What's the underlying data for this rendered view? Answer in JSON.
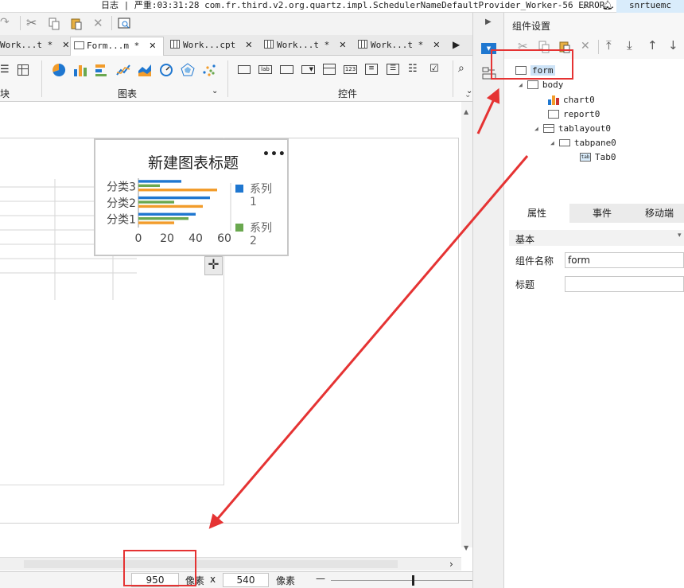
{
  "logbar": {
    "text": "日志 | 严重:03:31:28 com.fr.third.v2.org.quartz.impl.SchedulerNameDefaultProvider_Worker-56 ERROR...",
    "user": "snrtuemc"
  },
  "tabs": [
    {
      "label": "Work...t *",
      "active": false
    },
    {
      "label": "Form...m *",
      "active": true
    },
    {
      "label": "Work...cpt",
      "active": false
    },
    {
      "label": "Work...t *",
      "active": false
    },
    {
      "label": "Work...t *",
      "active": false
    }
  ],
  "ribbon": {
    "group_left": "块",
    "group_chart": "图表",
    "group_control": "控件"
  },
  "chart_data": {
    "type": "bar",
    "orientation": "horizontal",
    "title": "新建图表标题",
    "categories": [
      "分类1",
      "分类2",
      "分类3"
    ],
    "xticks": [
      "0",
      "20",
      "40",
      "60"
    ],
    "xlim": [
      0,
      60
    ],
    "legend": [
      "系列1",
      "系列2"
    ],
    "series": [
      {
        "name": "系列1",
        "color": "#1f77d0",
        "values": [
          40,
          50,
          30
        ]
      },
      {
        "name": "系列2",
        "color": "#6aa84f",
        "values": [
          35,
          25,
          15
        ]
      },
      {
        "name": "",
        "color": "#f29c2b",
        "values": [
          25,
          45,
          55
        ]
      }
    ]
  },
  "chart_menu_icon": "more-horizontal-icon",
  "statusbar": {
    "width_value": "950",
    "unit1": "像素",
    "times": "x",
    "height_value": "540",
    "unit2": "像素",
    "zoom_minus": "—"
  },
  "panel": {
    "title": "组件设置",
    "tree": [
      {
        "label": "form",
        "level": 0,
        "selected": true
      },
      {
        "label": "body",
        "level": 1
      },
      {
        "label": "chart0",
        "level": 2
      },
      {
        "label": "report0",
        "level": 2
      },
      {
        "label": "tablayout0",
        "level": 2
      },
      {
        "label": "tabpane0",
        "level": 3
      },
      {
        "label": "Tab0",
        "level": 4
      }
    ],
    "prop_tabs": [
      "属性",
      "事件",
      "移动端"
    ],
    "section": "基本",
    "fields": [
      {
        "label": "组件名称",
        "value": "form"
      },
      {
        "label": "标题",
        "value": ""
      }
    ]
  },
  "colors": {
    "accent": "#1f77d0",
    "annotation": "#e53333",
    "selection": "#cde3f7"
  }
}
